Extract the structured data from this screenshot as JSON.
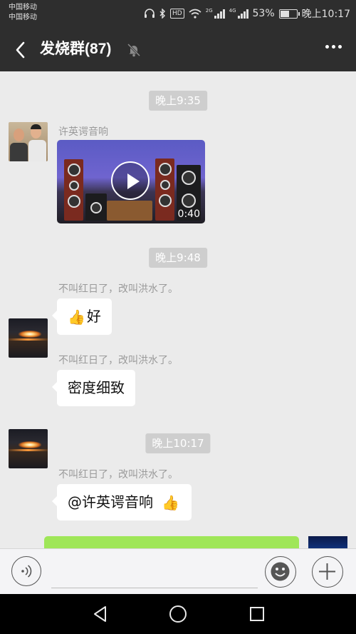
{
  "status_bar": {
    "carrier_1": "中国移动",
    "carrier_2": "中国移动",
    "network_1": "2G",
    "network_2": "4G",
    "battery": "53%",
    "battery_level": 0.53,
    "time": "晚上10:17",
    "icons": [
      "headphones-icon",
      "bluetooth-icon",
      "hd-icon",
      "wifi-icon",
      "signal-icon",
      "signal-icon",
      "battery-icon"
    ]
  },
  "header": {
    "back_icon": "back-arrow-icon",
    "title": "发烧群(87)",
    "mute_icon": "mute-bell-icon",
    "more_icon": "more-dots-icon"
  },
  "messages": [
    {
      "type": "time",
      "text": "晚上9:35"
    },
    {
      "type": "video",
      "sender": "许英谔音响",
      "duration": "0:40"
    },
    {
      "type": "time",
      "text": "晚上9:48"
    },
    {
      "type": "text",
      "sender": "不叫红日了，改叫洪水了。",
      "thumbs_up": "👍",
      "text": "好"
    },
    {
      "type": "text",
      "sender": "不叫红日了，改叫洪水了。",
      "text": "密度细致"
    },
    {
      "type": "time",
      "text": "晚上10:17"
    },
    {
      "type": "text",
      "sender": "不叫红日了，改叫洪水了。",
      "text": "@许英谔音响",
      "thumbs_up": "👍"
    }
  ],
  "input_bar": {
    "voice_icon": "voice-icon",
    "emoji_icon": "emoji-icon",
    "plus_icon": "plus-icon"
  },
  "nav_bar": {
    "back_icon": "nav-back-icon",
    "home_icon": "nav-home-icon",
    "recent_icon": "nav-recent-icon"
  },
  "colors": {
    "header_bg": "#2e2e2e",
    "chat_bg": "#ebebeb",
    "self_bubble": "#9fe658",
    "time_badge": "#cecece"
  }
}
